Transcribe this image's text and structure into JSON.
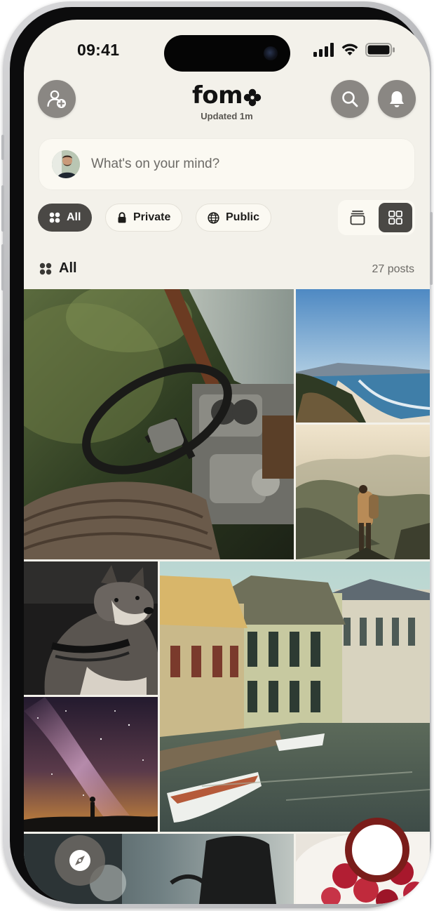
{
  "status_bar": {
    "time": "09:41"
  },
  "header": {
    "logo_text": "fom",
    "updated_label": "Updated 1m"
  },
  "icons": {
    "add_friend": "person-plus-icon",
    "search": "search-icon",
    "notifications": "bell-icon",
    "compass": "compass-icon",
    "camera": "camera-shutter-icon"
  },
  "composer": {
    "placeholder": "What's on your mind?"
  },
  "filters": [
    {
      "label": "All",
      "icon": "grid-dots-icon",
      "active": true
    },
    {
      "label": "Private",
      "icon": "lock-icon",
      "active": false
    },
    {
      "label": "Public",
      "icon": "globe-icon",
      "active": false
    }
  ],
  "view_toggle": {
    "options": [
      "stack-view",
      "grid-view"
    ],
    "selected": "grid-view"
  },
  "section": {
    "title": "All",
    "count_label": "27 posts"
  },
  "colors": {
    "background": "#f3f1ea",
    "chip_active": "#4a4845",
    "camera_ring": "#7a1d1a"
  }
}
